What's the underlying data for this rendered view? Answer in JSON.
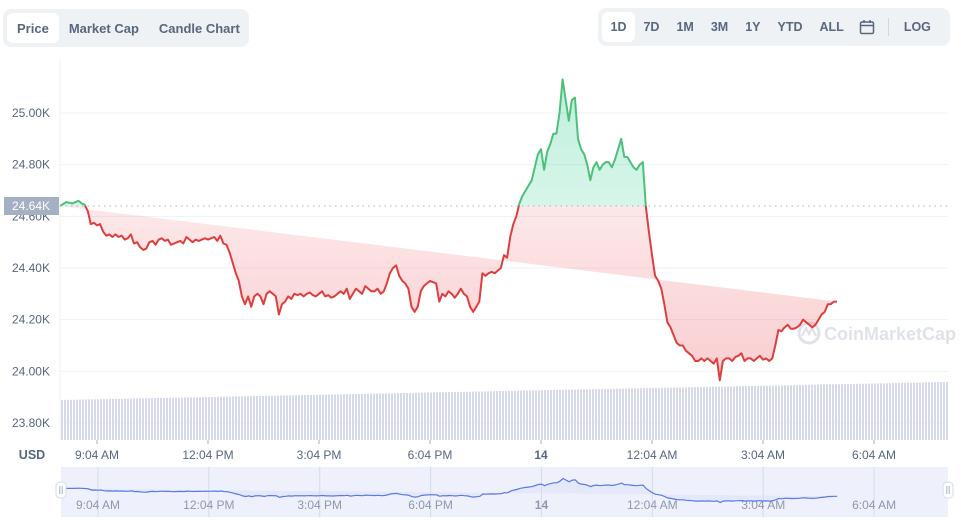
{
  "tabs_left": [
    {
      "label": "Price",
      "active": true
    },
    {
      "label": "Market Cap",
      "active": false
    },
    {
      "label": "Candle Chart",
      "active": false
    }
  ],
  "tabs_right": [
    {
      "label": "1D",
      "active": true
    },
    {
      "label": "7D",
      "active": false
    },
    {
      "label": "1M",
      "active": false
    },
    {
      "label": "3M",
      "active": false
    },
    {
      "label": "1Y",
      "active": false
    },
    {
      "label": "YTD",
      "active": false
    },
    {
      "label": "ALL",
      "active": false
    }
  ],
  "calendar_icon": "calendar-icon",
  "log_label": "LOG",
  "watermark": "CoinMarketCap",
  "colors": {
    "up": "#16c784",
    "up_line": "#4fbf7b",
    "down": "#ea3943",
    "down_line": "#dc3f3f",
    "volume": "#d5d9e8",
    "navigator_fill": "#e3e8fb",
    "navigator_line": "#5a7be0",
    "grid": "#eff2f5",
    "axis_text": "#58667e"
  },
  "chart_data": {
    "type": "line",
    "title": "",
    "currency_label": "USD",
    "baseline": 24640,
    "baseline_label": "24.64K",
    "ylim": [
      23760,
      25200
    ],
    "yticks": [
      23800,
      24000,
      24200,
      24400,
      24600,
      24800,
      25000
    ],
    "ytick_labels": [
      "23.80K",
      "24.00K",
      "24.20K",
      "24.40K",
      "24.60K",
      "24.80K",
      "25.00K"
    ],
    "xlim_minutes": [
      -60,
      1380
    ],
    "xticks_minutes": [
      0,
      180,
      360,
      540,
      720,
      900,
      1080,
      1260
    ],
    "xtick_labels": [
      "9:04 AM",
      "12:04 PM",
      "3:04 PM",
      "6:04 PM",
      "14",
      "12:04 AM",
      "3:04 AM",
      "6:04 AM"
    ],
    "xtick_bold": [
      false,
      false,
      false,
      false,
      true,
      false,
      false,
      false
    ],
    "grid": true,
    "x_minutes": [
      -60,
      -50,
      -40,
      -30,
      -25,
      -20,
      -15,
      -10,
      -5,
      0,
      5,
      10,
      15,
      20,
      25,
      30,
      35,
      40,
      45,
      50,
      55,
      60,
      65,
      70,
      75,
      80,
      85,
      90,
      95,
      100,
      105,
      110,
      115,
      120,
      125,
      130,
      135,
      140,
      145,
      150,
      155,
      160,
      165,
      170,
      175,
      180,
      185,
      190,
      195,
      200,
      205,
      210,
      215,
      220,
      225,
      230,
      235,
      240,
      245,
      250,
      255,
      260,
      265,
      270,
      275,
      280,
      285,
      290,
      295,
      300,
      305,
      310,
      315,
      320,
      325,
      330,
      335,
      340,
      345,
      350,
      355,
      360,
      365,
      370,
      375,
      380,
      385,
      390,
      395,
      400,
      405,
      410,
      415,
      420,
      425,
      430,
      435,
      440,
      445,
      450,
      455,
      460,
      465,
      470,
      475,
      480,
      485,
      490,
      495,
      500,
      505,
      510,
      515,
      520,
      525,
      530,
      535,
      540,
      545,
      550,
      555,
      560,
      565,
      570,
      575,
      580,
      585,
      590,
      595,
      600,
      605,
      610,
      615,
      620,
      625,
      630,
      635,
      640,
      645,
      650,
      655,
      660,
      665,
      670,
      675,
      680,
      685,
      690,
      695,
      700,
      705,
      710,
      715,
      720,
      725,
      730,
      735,
      740,
      745,
      750,
      755,
      760,
      765,
      770,
      775,
      780,
      785,
      790,
      795,
      800,
      805,
      810,
      815,
      820,
      825,
      830,
      835,
      840,
      845,
      850,
      855,
      860,
      865,
      870,
      875,
      880,
      885,
      890,
      895,
      900,
      905,
      910,
      915,
      920,
      925,
      930,
      935,
      940,
      945,
      950,
      955,
      960,
      965,
      970,
      975,
      980,
      985,
      990,
      995,
      1000,
      1005,
      1010,
      1015,
      1020,
      1025,
      1030,
      1035,
      1040,
      1045,
      1050,
      1055,
      1060,
      1065,
      1070,
      1075,
      1080,
      1085,
      1090,
      1095,
      1100,
      1105,
      1110,
      1115,
      1120,
      1125,
      1130,
      1135,
      1140,
      1145,
      1150,
      1155,
      1160,
      1165,
      1170,
      1175,
      1180,
      1185,
      1190,
      1195,
      1200,
      1205,
      1210,
      1215,
      1220,
      1225,
      1230,
      1235,
      1240,
      1245,
      1250,
      1255,
      1260,
      1265,
      1270,
      1275,
      1280,
      1285,
      1290,
      1295,
      1300,
      1305,
      1310,
      1315,
      1320,
      1325,
      1330,
      1335,
      1340,
      1345,
      1350,
      1355,
      1360,
      1365,
      1370,
      1375,
      1380
    ],
    "price": [
      24640,
      24655,
      24650,
      24660,
      24650,
      24645,
      24620,
      24570,
      24575,
      24565,
      24570,
      24540,
      24525,
      24530,
      24520,
      24530,
      24520,
      24525,
      24510,
      24515,
      24530,
      24495,
      24500,
      24480,
      24470,
      24475,
      24500,
      24505,
      24490,
      24510,
      24515,
      24505,
      24510,
      24490,
      24495,
      24500,
      24505,
      24495,
      24520,
      24510,
      24500,
      24510,
      24505,
      24510,
      24515,
      24510,
      24515,
      24520,
      24505,
      24525,
      24495,
      24490,
      24460,
      24420,
      24380,
      24350,
      24290,
      24260,
      24290,
      24250,
      24290,
      24300,
      24290,
      24260,
      24300,
      24310,
      24300,
      24290,
      24220,
      24260,
      24270,
      24290,
      24280,
      24300,
      24295,
      24300,
      24290,
      24300,
      24305,
      24295,
      24290,
      24300,
      24310,
      24290,
      24295,
      24285,
      24290,
      24300,
      24310,
      24300,
      24320,
      24280,
      24300,
      24320,
      24310,
      24300,
      24330,
      24320,
      24310,
      24310,
      24320,
      24300,
      24310,
      24340,
      24380,
      24400,
      24410,
      24370,
      24350,
      24340,
      24320,
      24250,
      24230,
      24250,
      24310,
      24330,
      24340,
      24350,
      24345,
      24340,
      24270,
      24300,
      24290,
      24310,
      24300,
      24285,
      24300,
      24320,
      24300,
      24290,
      24250,
      24230,
      24250,
      24270,
      24380,
      24370,
      24380,
      24385,
      24380,
      24390,
      24400,
      24450,
      24440,
      24520,
      24570,
      24600,
      24650,
      24680,
      24700,
      24720,
      24740,
      24790,
      24840,
      24860,
      24780,
      24850,
      24880,
      24920,
      24920,
      25000,
      25130,
      25050,
      24970,
      25050,
      25060,
      24900,
      24860,
      24840,
      24800,
      24740,
      24790,
      24810,
      24780,
      24800,
      24810,
      24810,
      24790,
      24820,
      24860,
      24900,
      24830,
      24830,
      24810,
      24790,
      24780,
      24800,
      24810,
      24640,
      24540,
      24450,
      24370,
      24350,
      24320,
      24260,
      24190,
      24170,
      24140,
      24110,
      24100,
      24100,
      24080,
      24070,
      24060,
      24040,
      24040,
      24050,
      24040,
      24050,
      24040,
      24030,
      24050,
      23965,
      24040,
      24050,
      24050,
      24040,
      24055,
      24060,
      24070,
      24040,
      24050,
      24050,
      24040,
      24050,
      24060,
      24045,
      24050,
      24040,
      24050,
      24100,
      24160,
      24155,
      24170,
      24180,
      24165,
      24165,
      24170,
      24180,
      24200,
      24190,
      24180,
      24170,
      24180,
      24200,
      24220,
      24230,
      24260,
      24260,
      24270,
      24270
    ],
    "volume_note": "Volume bars shown as uniform light columns along bottom of chart",
    "navigator": {
      "xtick_labels": [
        "9:04 AM",
        "12:04 PM",
        "3:04 PM",
        "6:04 PM",
        "14",
        "12:04 AM",
        "3:04 AM",
        "6:04 AM"
      ],
      "range_fraction": [
        0,
        1
      ]
    }
  }
}
